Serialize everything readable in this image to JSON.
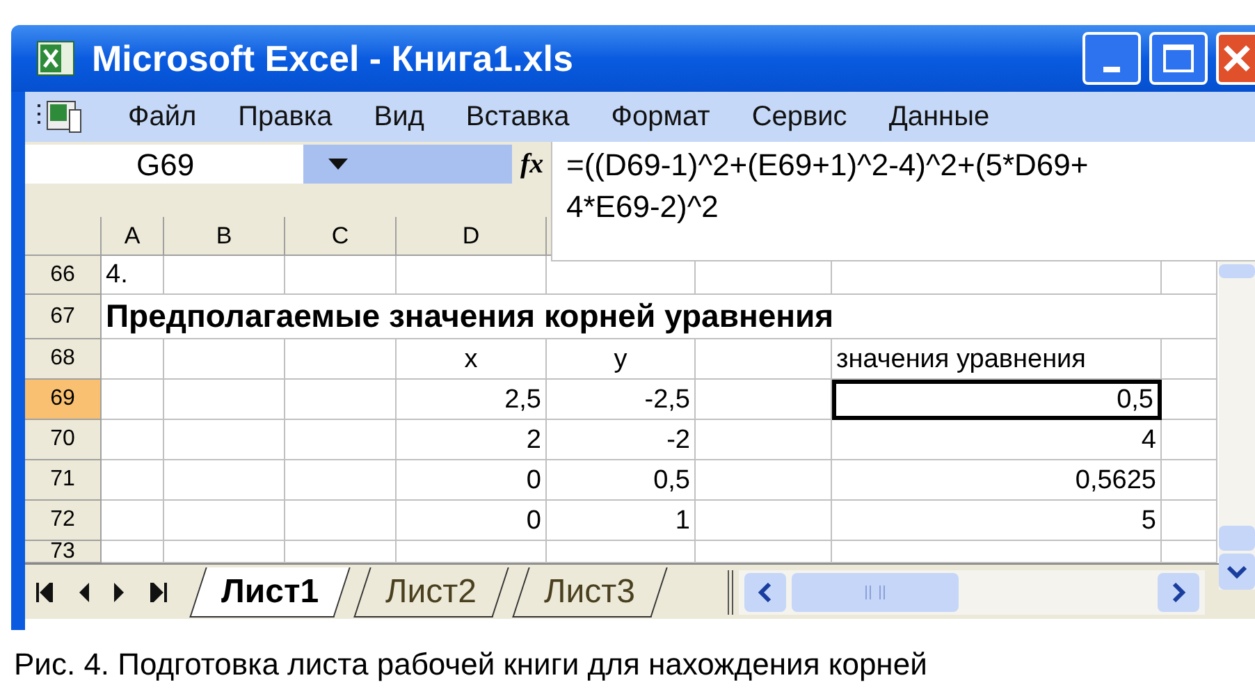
{
  "window": {
    "title": "Microsoft Excel - Книга1.xls"
  },
  "menu": [
    {
      "label": "Файл"
    },
    {
      "label": "Правка"
    },
    {
      "label": "Вид"
    },
    {
      "label": "Вставка"
    },
    {
      "label": "Формат"
    },
    {
      "label": "Сервис"
    },
    {
      "label": "Данные"
    }
  ],
  "formula_bar": {
    "name_box": "G69",
    "fx": "fx",
    "formula_lines": [
      "=((D69-1)^2+(E69+1)^2-4)^2+(5*D69+",
      "4*E69-2)^2"
    ]
  },
  "columns": [
    "A",
    "B",
    "C",
    "D"
  ],
  "rows": [
    {
      "header": "66",
      "selected": false,
      "a": "4."
    },
    {
      "header": "67",
      "selected": false,
      "span": "Предполагаемые значения корней уравнения"
    },
    {
      "header": "68",
      "selected": false,
      "d": "x",
      "e": "y",
      "g": "значения уравнения"
    },
    {
      "header": "69",
      "selected": true,
      "d": "2,5",
      "e": "-2,5",
      "g": "0,5"
    },
    {
      "header": "70",
      "selected": false,
      "d": "2",
      "e": "-2",
      "g": "4"
    },
    {
      "header": "71",
      "selected": false,
      "d": "0",
      "e": "0,5",
      "g": "0,5625"
    },
    {
      "header": "72",
      "selected": false,
      "d": "0",
      "e": "1",
      "g": "5"
    },
    {
      "header": "73",
      "selected": false
    }
  ],
  "sheet_tabs": [
    {
      "label": "Лист1",
      "selected": true
    },
    {
      "label": "Лист2",
      "selected": false
    },
    {
      "label": "Лист3",
      "selected": false
    }
  ],
  "caption": "Рис. 4. Подготовка листа рабочей книги для нахождения корней"
}
